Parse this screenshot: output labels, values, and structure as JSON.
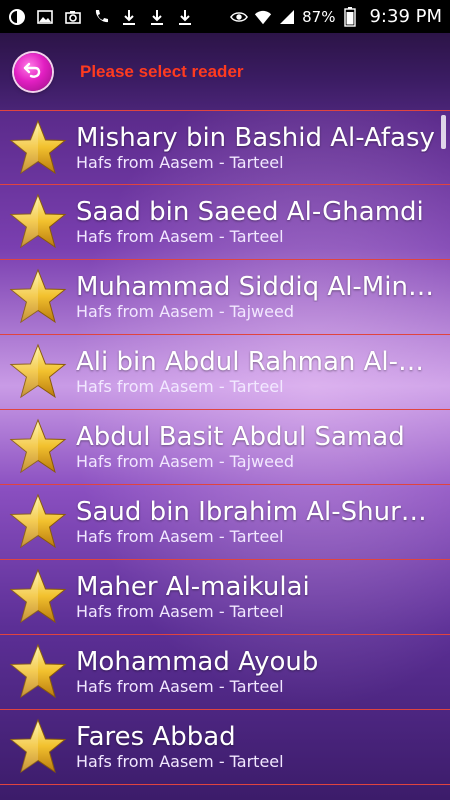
{
  "status_bar": {
    "battery_percent": "87%",
    "time": "9:39 PM"
  },
  "header": {
    "title": "Please select reader"
  },
  "readers": [
    {
      "name": "Mishary bin Bashid Al-Afasy",
      "narration": "Hafs from Aasem - Tarteel"
    },
    {
      "name": "Saad bin Saeed Al-Ghamdi",
      "narration": "Hafs from Aasem - Tarteel"
    },
    {
      "name": "Muhammad Siddiq Al-Minshawi",
      "narration": "Hafs from Aasem - Tajweed"
    },
    {
      "name": "Ali bin Abdul Rahman Al-Huthaify",
      "narration": "Hafs from Aasem - Tarteel"
    },
    {
      "name": "Abdul Basit Abdul Samad",
      "narration": "Hafs from Aasem - Tajweed"
    },
    {
      "name": "Saud bin Ibrahim Al-Shuraim",
      "narration": "Hafs from Aasem - Tarteel"
    },
    {
      "name": "Maher Al-maikulai",
      "narration": "Hafs from Aasem - Tarteel"
    },
    {
      "name": "Mohammad Ayoub",
      "narration": "Hafs from Aasem - Tarteel"
    },
    {
      "name": "Fares Abbad",
      "narration": "Hafs from Aasem - Tarteel"
    }
  ],
  "colors": {
    "accent_title": "#ff3b1f",
    "divider": "#e0443f",
    "back_button": "#e21fc2",
    "star": "#f2c12e"
  },
  "icons": {
    "back": "back-arrow-icon",
    "row": "star-icon"
  }
}
